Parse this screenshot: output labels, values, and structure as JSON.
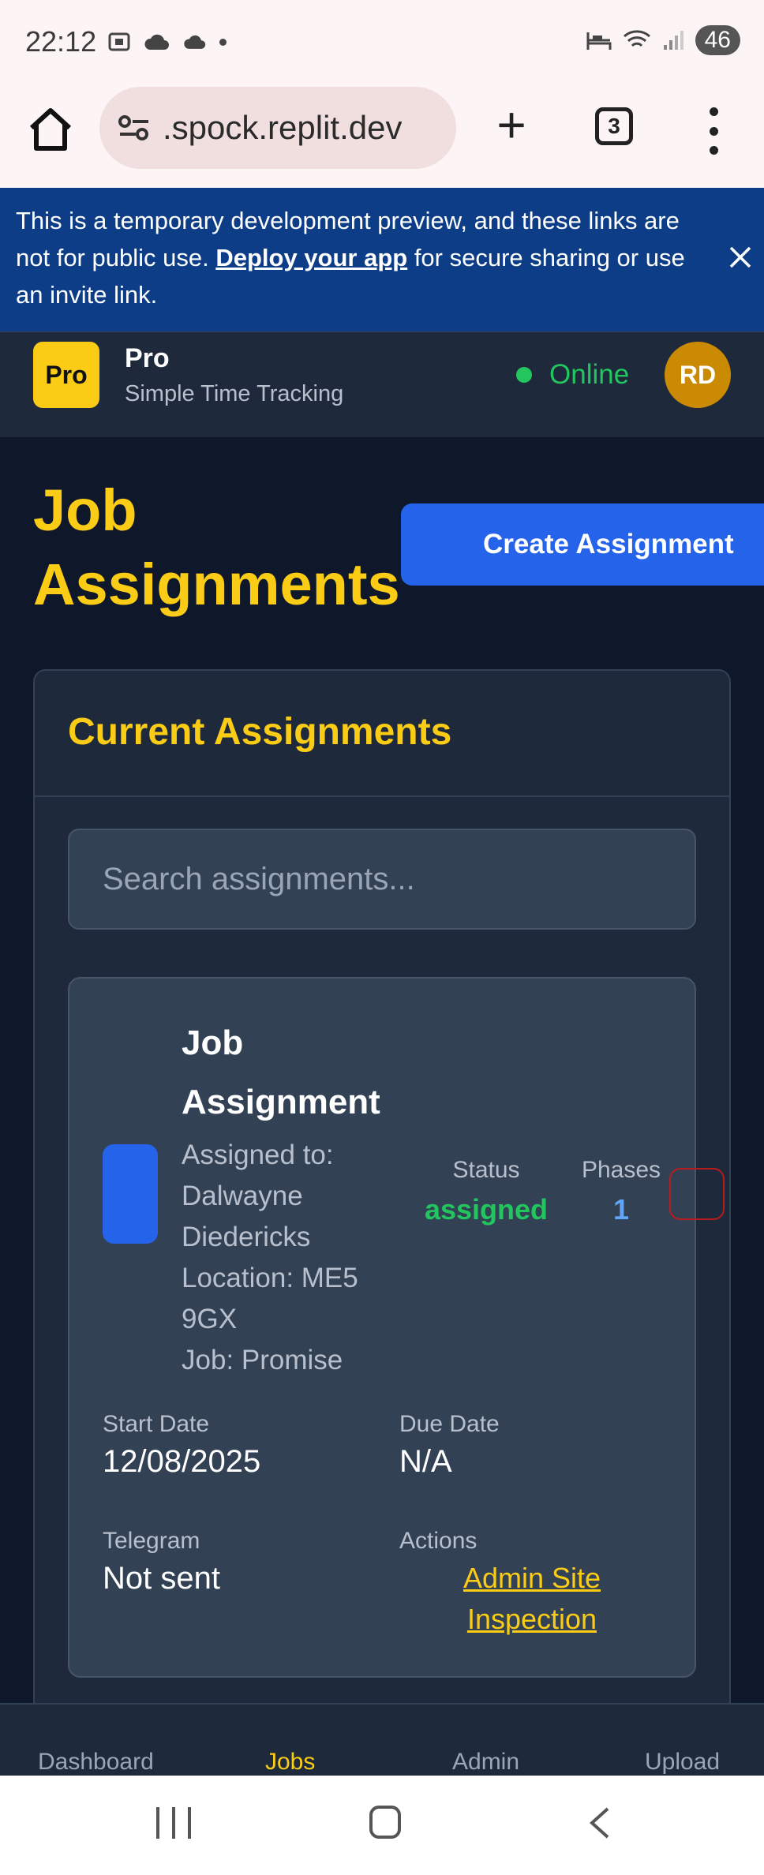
{
  "status_bar": {
    "time": "22:12",
    "battery": "46"
  },
  "browser": {
    "url": ".spock.replit.dev",
    "tab_count": "3"
  },
  "banner": {
    "text_before": "This is a temporary development preview, and these links are not for public use. ",
    "link": "Deploy your app",
    "text_after": " for secure sharing or use an invite link."
  },
  "header": {
    "logo": "Pro",
    "brand_name": "Pro",
    "brand_sub": "Simple Time Tracking",
    "status": "Online",
    "avatar": "RD"
  },
  "page": {
    "title": "Job Assignments",
    "create_button": "Create Assignment"
  },
  "current": {
    "title": "Current Assignments",
    "search_placeholder": "Search assignments..."
  },
  "assignment": {
    "title": "Job Assignment",
    "assigned_to": "Assigned to: Dalwayne Diedericks",
    "location": "Location: ME5 9GX",
    "job": "Job: Promise",
    "status_label": "Status",
    "status_value": "assigned",
    "phases_label": "Phases",
    "phases_value": "1",
    "start_label": "Start Date",
    "start_value": "12/08/2025",
    "due_label": "Due Date",
    "due_value": "N/A",
    "telegram_label": "Telegram",
    "telegram_value": "Not sent",
    "actions_label": "Actions",
    "action_link": "Admin Site Inspection"
  },
  "bottom_nav": [
    "Dashboard",
    "Jobs",
    "Admin",
    "Upload"
  ],
  "colors": {
    "accent": "#facc15",
    "primary": "#2563eb",
    "online": "#22c55e",
    "banner": "#0c3d86"
  }
}
